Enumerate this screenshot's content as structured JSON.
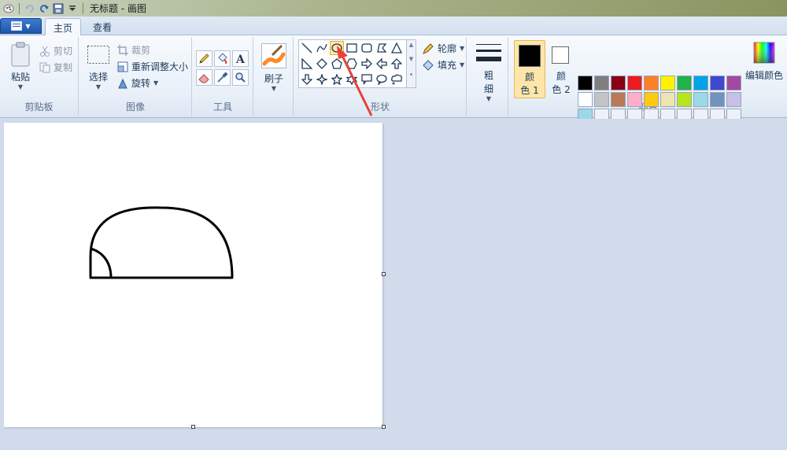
{
  "window": {
    "title": "无标题 - 画图"
  },
  "tabs": [
    {
      "label": "主页",
      "active": true
    },
    {
      "label": "查看",
      "active": false
    }
  ],
  "groups": {
    "clipboard": {
      "label": "剪贴板",
      "paste": "粘贴",
      "cut": "剪切",
      "copy": "复制"
    },
    "image": {
      "label": "图像",
      "select": "选择",
      "crop": "裁剪",
      "resize": "重新调整大小",
      "rotate": "旋转"
    },
    "tools": {
      "label": "工具"
    },
    "brushes": {
      "label": "刷子"
    },
    "shapes": {
      "label": "形状",
      "outline": "轮廓",
      "fill": "填充"
    },
    "size": {
      "label_line1": "粗",
      "label_line2": "细"
    },
    "colors": {
      "label": "颜色",
      "color1_line1": "颜",
      "color1_line2": "色 1",
      "color2_line1": "颜",
      "color2_line2": "色 2",
      "edit": "编辑颜色",
      "row1": [
        "#000000",
        "#7f7f7f",
        "#880015",
        "#ed1c24",
        "#ff7f27",
        "#fff200",
        "#22b14c",
        "#00a2e8",
        "#3f48cc",
        "#a349a4"
      ],
      "row2": [
        "#ffffff",
        "#c3c3c3",
        "#b97a57",
        "#ffaec9",
        "#ffc90e",
        "#efe4b0",
        "#b5e61d",
        "#99d9ea",
        "#7092be",
        "#c8bfe7"
      ],
      "row3": [
        "#99d9ea",
        "#eef2f8",
        "#eef2f8",
        "#eef2f8",
        "#eef2f8",
        "#eef2f8",
        "#eef2f8",
        "#eef2f8",
        "#eef2f8",
        "#eef2f8"
      ],
      "primary": "#000000",
      "secondary": "#ffffff"
    }
  },
  "accent": {
    "selected_tool": "#fde6a8",
    "arrow": "#e8423a"
  }
}
